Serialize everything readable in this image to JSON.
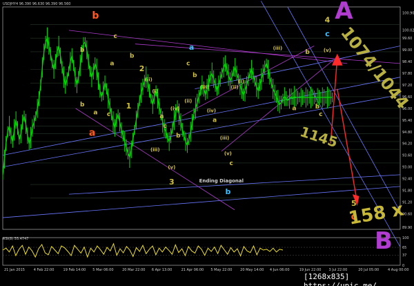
{
  "chart_data": {
    "type": "line",
    "title": "USDJHY4 96.390 96.630 96.390 96.560",
    "oscillator_title": "RSI(8) 55.4747",
    "watermark": "[1268x835] https://upic.me/",
    "y_axis_ticks": [
      "100.90",
      "100.02",
      "99.60",
      "99.00",
      "98.40",
      "97.80",
      "97.20",
      "96.60",
      "96.00",
      "95.40",
      "94.80",
      "94.20",
      "93.60",
      "93.00",
      "92.40",
      "91.80",
      "91.20",
      "90.60",
      "89.90"
    ],
    "y_range": [
      89.8,
      101.2
    ],
    "osc_ticks": [
      "100",
      "65",
      "37",
      "0"
    ],
    "x_ticks": [
      "21 Jan 2015",
      "4 Feb 22:00",
      "19 Feb 14:00",
      "5 Mar 06:00",
      "20 Mar 22:00",
      "6 Apr 13:00",
      "21 Apr 06:00",
      "5 May 22:00",
      "20 May 14:00",
      "4 Jun 06:00",
      "19 Jun 22:00",
      "3 Jul 22:00",
      "20 Jul 05:00",
      "4 Aug 00:00"
    ],
    "series": [
      {
        "color": "#00e000",
        "x": [
          0,
          1,
          2,
          3,
          4,
          5,
          6,
          7,
          8,
          9,
          10,
          11,
          12,
          13,
          14,
          15,
          16,
          17,
          18,
          19,
          20,
          21,
          22,
          23,
          24,
          25,
          26,
          27,
          28,
          29,
          30,
          31,
          32,
          33,
          34,
          35,
          36,
          37,
          38,
          39,
          40,
          41,
          42,
          43,
          44,
          45,
          46,
          47,
          48,
          49,
          50,
          51,
          52,
          53,
          54,
          55,
          56,
          57,
          58,
          59,
          60,
          61,
          62,
          63,
          64,
          65,
          66,
          67,
          68,
          69,
          70,
          71,
          72,
          73,
          74,
          75,
          76,
          77,
          78,
          79,
          80,
          81,
          82,
          83,
          84,
          85,
          86,
          87,
          88,
          89,
          90,
          91,
          92,
          93,
          94,
          95,
          96,
          97,
          98,
          99,
          100,
          101,
          102,
          103,
          104,
          105,
          106,
          107,
          108,
          109,
          110,
          111,
          112,
          113,
          114,
          115,
          116,
          117,
          118,
          119,
          120,
          121,
          122,
          123,
          124,
          125,
          126,
          127,
          128,
          129,
          130,
          131,
          132,
          133,
          134,
          135,
          136,
          137,
          138,
          139,
          140,
          141,
          142,
          143,
          144,
          145,
          146,
          147,
          148,
          149,
          150,
          151,
          152,
          153,
          154,
          155,
          156,
          157,
          158,
          159,
          160,
          161,
          162,
          163,
          164,
          165,
          166,
          167,
          168,
          169,
          170,
          171,
          172,
          173,
          174,
          175,
          176,
          177,
          178,
          179,
          180,
          181,
          182,
          183,
          184,
          185,
          186,
          187,
          188,
          189,
          190,
          191,
          192,
          193,
          194,
          195,
          196,
          197,
          198,
          199,
          200
        ],
        "y": [
          92.6,
          93.4,
          94.2,
          94.8,
          95.1,
          94.6,
          94.3,
          94.9,
          95.4,
          95.0,
          94.4,
          94.7,
          95.3,
          95.6,
          95.2,
          94.6,
          94.2,
          94.5,
          95.0,
          95.3,
          95.6,
          96.0,
          96.5,
          97.2,
          98.1,
          98.9,
          99.4,
          99.6,
          99.2,
          98.8,
          98.3,
          98.0,
          98.4,
          98.9,
          99.2,
          98.7,
          98.1,
          97.6,
          97.2,
          97.5,
          97.9,
          98.4,
          98.7,
          98.2,
          97.6,
          97.2,
          97.6,
          98.2,
          98.8,
          99.3,
          99.4,
          99.0,
          98.4,
          97.9,
          97.6,
          97.9,
          98.3,
          98.0,
          97.4,
          96.9,
          96.6,
          96.9,
          97.3,
          97.0,
          96.5,
          96.1,
          95.7,
          95.3,
          95.0,
          95.4,
          95.7,
          95.3,
          94.9,
          94.6,
          94.3,
          94.0,
          93.7,
          93.5,
          93.9,
          94.4,
          94.9,
          95.4,
          95.9,
          96.4,
          96.8,
          97.1,
          97.4,
          97.6,
          97.3,
          96.9,
          96.5,
          96.2,
          96.6,
          96.9,
          96.5,
          96.1,
          95.7,
          95.3,
          95.0,
          94.8,
          94.5,
          94.3,
          94.6,
          95.0,
          95.4,
          95.8,
          96.1,
          95.7,
          95.3,
          94.9,
          94.6,
          94.3,
          94.1,
          94.4,
          94.8,
          95.3,
          95.7,
          96.0,
          96.3,
          96.6,
          96.9,
          97.2,
          97.0,
          96.7,
          97.0,
          97.3,
          97.6,
          97.8,
          97.5,
          97.2,
          96.9,
          97.2,
          97.5,
          97.8,
          98.1,
          98.3,
          98.0,
          97.7,
          97.4,
          97.6,
          97.9,
          98.1,
          97.8,
          97.5,
          97.2,
          96.9,
          96.7,
          96.9,
          97.2,
          97.5,
          97.8,
          98.0,
          97.7,
          97.4,
          97.1,
          96.9,
          97.2,
          97.5,
          97.8,
          98.1,
          98.3,
          98.0,
          97.6,
          97.3,
          97.0,
          96.8,
          96.6,
          96.4,
          96.2,
          96.3,
          96.5,
          96.6,
          96.5,
          96.4,
          96.5,
          96.6,
          96.5,
          96.6,
          96.56,
          96.56,
          96.56,
          96.56,
          96.56,
          96.56,
          96.56,
          96.56,
          96.56,
          96.56,
          96.56,
          96.56,
          96.56,
          96.56,
          96.56,
          96.56,
          96.56,
          96.56,
          96.56,
          96.56,
          96.56,
          96.56,
          96.56
        ]
      }
    ],
    "wave_labels": [
      {
        "text": "b",
        "color": "#ff5a1e",
        "x": 28,
        "y": 100.6,
        "size": 14
      },
      {
        "text": "c",
        "color": "#d0c040",
        "x": 34,
        "y": 99.6,
        "size": 9
      },
      {
        "text": "b",
        "color": "#d0c040",
        "x": 24,
        "y": 98.9,
        "size": 9
      },
      {
        "text": "a",
        "color": "#d0c040",
        "x": 33,
        "y": 98.2,
        "size": 9
      },
      {
        "text": "b",
        "color": "#d0c040",
        "x": 39,
        "y": 98.6,
        "size": 9
      },
      {
        "text": "2",
        "color": "#d0c040",
        "x": 42,
        "y": 97.9,
        "size": 11
      },
      {
        "text": "(ii)",
        "color": "#d0c040",
        "x": 44,
        "y": 97.4,
        "size": 7
      },
      {
        "text": "(i)",
        "color": "#d0c040",
        "x": 46,
        "y": 96.8,
        "size": 7
      },
      {
        "text": "1",
        "color": "#d0c040",
        "x": 38,
        "y": 96.0,
        "size": 11
      },
      {
        "text": "a",
        "color": "#d0c040",
        "x": 28,
        "y": 95.7,
        "size": 9
      },
      {
        "text": "b",
        "color": "#d0c040",
        "x": 24,
        "y": 96.1,
        "size": 9
      },
      {
        "text": "c",
        "color": "#d0c040",
        "x": 32,
        "y": 95.6,
        "size": 9
      },
      {
        "text": "a",
        "color": "#ff5a1e",
        "x": 27,
        "y": 94.6,
        "size": 14
      },
      {
        "text": "(iv)",
        "color": "#d0c040",
        "x": 52,
        "y": 95.9,
        "size": 7
      },
      {
        "text": "a",
        "color": "#d0c040",
        "x": 48,
        "y": 95.5,
        "size": 9
      },
      {
        "text": "c",
        "color": "#d0c040",
        "x": 49,
        "y": 95.0,
        "size": 9
      },
      {
        "text": "(iii)",
        "color": "#d0c040",
        "x": 46,
        "y": 93.8,
        "size": 7
      },
      {
        "text": "(v)",
        "color": "#d0c040",
        "x": 51,
        "y": 92.9,
        "size": 7
      },
      {
        "text": "3",
        "color": "#d0c040",
        "x": 51,
        "y": 92.1,
        "size": 11
      },
      {
        "text": "b",
        "color": "#d0c040",
        "x": 53,
        "y": 94.5,
        "size": 9
      },
      {
        "text": "a",
        "color": "#3ec0ff",
        "x": 57,
        "y": 99.0,
        "size": 11
      },
      {
        "text": "c",
        "color": "#d0c040",
        "x": 56,
        "y": 98.2,
        "size": 9
      },
      {
        "text": "b",
        "color": "#d0c040",
        "x": 58,
        "y": 97.6,
        "size": 9
      },
      {
        "text": "(iii)",
        "color": "#d0c040",
        "x": 61,
        "y": 97.0,
        "size": 7
      },
      {
        "text": "(ii)",
        "color": "#d0c040",
        "x": 56,
        "y": 96.3,
        "size": 7
      },
      {
        "text": "(iv)",
        "color": "#d0c040",
        "x": 63,
        "y": 95.8,
        "size": 7
      },
      {
        "text": "a",
        "color": "#d0c040",
        "x": 64,
        "y": 95.3,
        "size": 9
      },
      {
        "text": "(v)",
        "color": "#d0c040",
        "x": 68,
        "y": 93.6,
        "size": 7
      },
      {
        "text": "c",
        "color": "#d0c040",
        "x": 69,
        "y": 93.1,
        "size": 9
      },
      {
        "text": "(ii)",
        "color": "#d0c040",
        "x": 70,
        "y": 97.0,
        "size": 7
      },
      {
        "text": "(i)",
        "color": "#d0c040",
        "x": 72,
        "y": 97.3,
        "size": 7
      },
      {
        "text": "(iii)",
        "color": "#d0c040",
        "x": 67,
        "y": 94.4,
        "size": 7
      },
      {
        "text": "b",
        "color": "#3ec0ff",
        "x": 68,
        "y": 91.6,
        "size": 11
      },
      {
        "text": "(iii)",
        "color": "#d0c040",
        "x": 83,
        "y": 99.0,
        "size": 7
      },
      {
        "text": "a",
        "color": "#d0c040",
        "x": 88,
        "y": 95.9,
        "size": 9
      },
      {
        "text": "b",
        "color": "#d0c040",
        "x": 92,
        "y": 98.8,
        "size": 9
      },
      {
        "text": "4",
        "color": "#d0c040",
        "x": 98,
        "y": 100.4,
        "size": 11
      },
      {
        "text": "c",
        "color": "#3ec0ff",
        "x": 98,
        "y": 99.7,
        "size": 11
      },
      {
        "text": "(v)",
        "color": "#d0c040",
        "x": 98,
        "y": 98.9,
        "size": 7
      },
      {
        "text": "c",
        "color": "#d0c040",
        "x": 96,
        "y": 95.6,
        "size": 9
      },
      {
        "text": "b",
        "color": "#d0c040",
        "x": 95,
        "y": 96.0,
        "size": 9
      },
      {
        "text": "5",
        "color": "#d0c040",
        "x": 106,
        "y": 91.0,
        "size": 11
      },
      {
        "text": "c",
        "color": "#ff5a1e",
        "x": 106,
        "y": 90.3,
        "size": 14
      }
    ],
    "annotations": [
      {
        "text": "Ending Diagonal",
        "color": "#d0d0d0",
        "x": 66,
        "y": 92.2,
        "size": 7
      },
      {
        "text": "A",
        "color": "#b03cd0",
        "x": 103,
        "y": 100.6,
        "size": 34
      },
      {
        "text": "1074/1044",
        "color": "#b8b040",
        "x": 111,
        "y": 97.9,
        "size": 24,
        "rotate": 52
      },
      {
        "text": "1145",
        "color": "#b8b040",
        "x": 95,
        "y": 94.3,
        "size": 20,
        "rotate": 18
      },
      {
        "text": "158 x",
        "color": "#c8b838",
        "x": 113,
        "y": 90.3,
        "size": 26,
        "rotate": -10
      },
      {
        "text": "B",
        "color": "#b03cd0",
        "x": 115,
        "y": 88.8,
        "size": 34
      }
    ]
  },
  "osc_series_y": [
    55,
    62,
    48,
    70,
    35,
    58,
    72,
    40,
    66,
    52,
    30,
    60,
    75,
    45,
    38,
    68,
    55,
    42,
    70,
    63,
    50,
    35,
    72,
    58,
    44,
    66,
    30,
    62,
    48,
    70,
    56,
    40,
    65,
    52,
    78,
    36,
    60,
    45,
    68,
    55,
    32,
    64,
    50,
    72,
    42,
    58,
    70,
    38,
    62,
    48,
    66,
    54,
    40,
    74,
    46,
    60,
    35,
    68,
    52,
    44,
    70,
    58,
    36,
    62,
    50,
    66,
    42,
    72,
    56,
    40,
    64,
    48,
    60,
    34,
    68,
    52,
    46,
    70,
    38,
    62,
    55,
    58,
    50,
    62,
    48,
    58,
    55
  ],
  "colors": {
    "background": "#000000",
    "price": "#00e000",
    "osc": "#f0e020",
    "purple_line": "#b03cd0",
    "blue_line": "#6a78ff",
    "grid": "#2a3a2a",
    "arrow": "#ff2a2a"
  }
}
